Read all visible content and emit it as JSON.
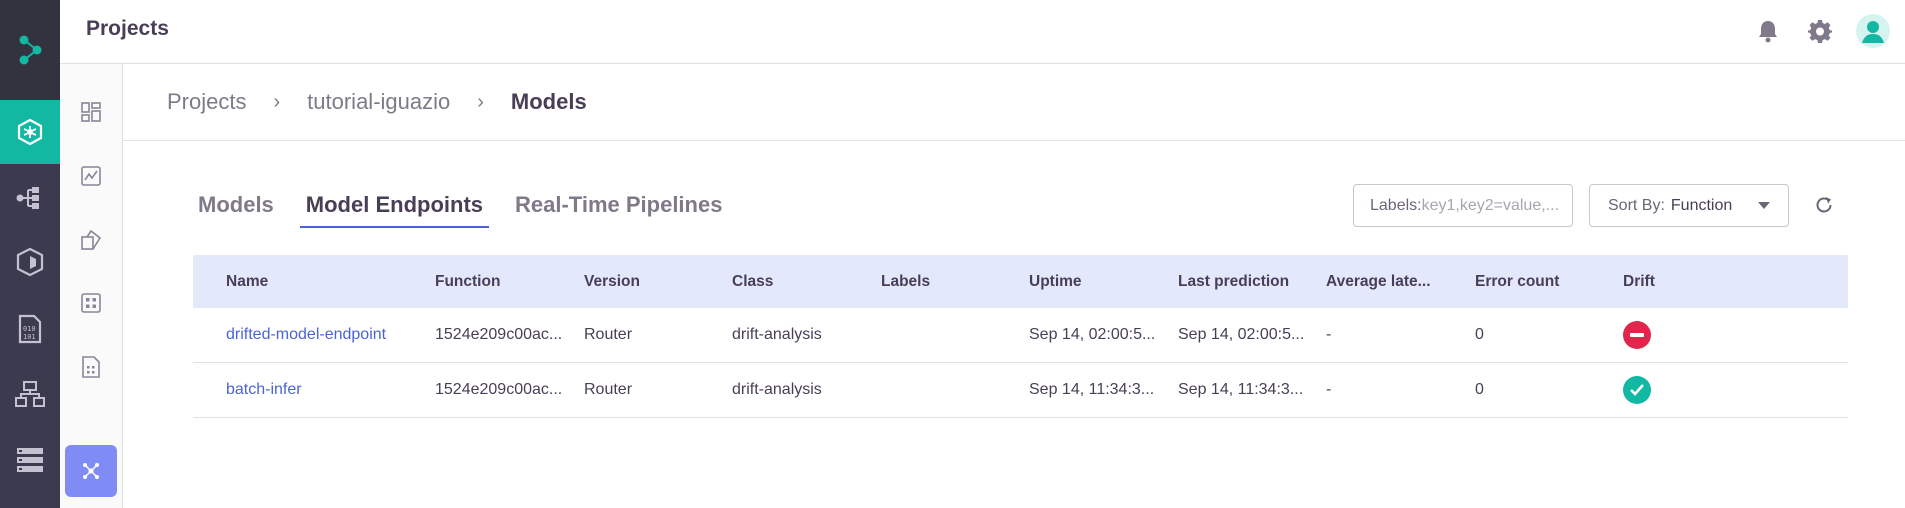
{
  "header": {
    "title": "Projects"
  },
  "breadcrumb": {
    "items": [
      "Projects",
      "tutorial-iguazio"
    ],
    "current": "Models",
    "separator": "›"
  },
  "tabs": [
    {
      "label": "Models",
      "active": false
    },
    {
      "label": "Model Endpoints",
      "active": true
    },
    {
      "label": "Real-Time Pipelines",
      "active": false
    }
  ],
  "filters": {
    "labels_prefix": "Labels:",
    "labels_placeholder": "key1,key2=value,...",
    "sort_label": "Sort By:",
    "sort_value": "Function"
  },
  "table": {
    "columns": [
      "Name",
      "Function",
      "Version",
      "Class",
      "Labels",
      "Uptime",
      "Last prediction",
      "Average late...",
      "Error count",
      "Drift"
    ],
    "rows": [
      {
        "name": "drifted-model-endpoint",
        "function": "1524e209c00ac...",
        "version": "Router",
        "class": "drift-analysis",
        "labels": "",
        "uptime": "Sep 14, 02:00:5...",
        "last_prediction": "Sep 14, 02:00:5...",
        "average_latency": "-",
        "error_count": "0",
        "drift": "drift-detected-icon"
      },
      {
        "name": "batch-infer",
        "function": "1524e209c00ac...",
        "version": "Router",
        "class": "drift-analysis",
        "labels": "",
        "uptime": "Sep 14, 11:34:3...",
        "last_prediction": "Sep 14, 11:34:3...",
        "average_latency": "-",
        "error_count": "0",
        "drift": "no-drift-icon"
      }
    ]
  },
  "colors": {
    "rail": "#3b3a4f",
    "rail_active": "#13b8a3",
    "accent": "#4b63d6",
    "table_header": "#e4e8fb",
    "drift_error": "#e1264e",
    "drift_ok": "#13b8a3"
  }
}
